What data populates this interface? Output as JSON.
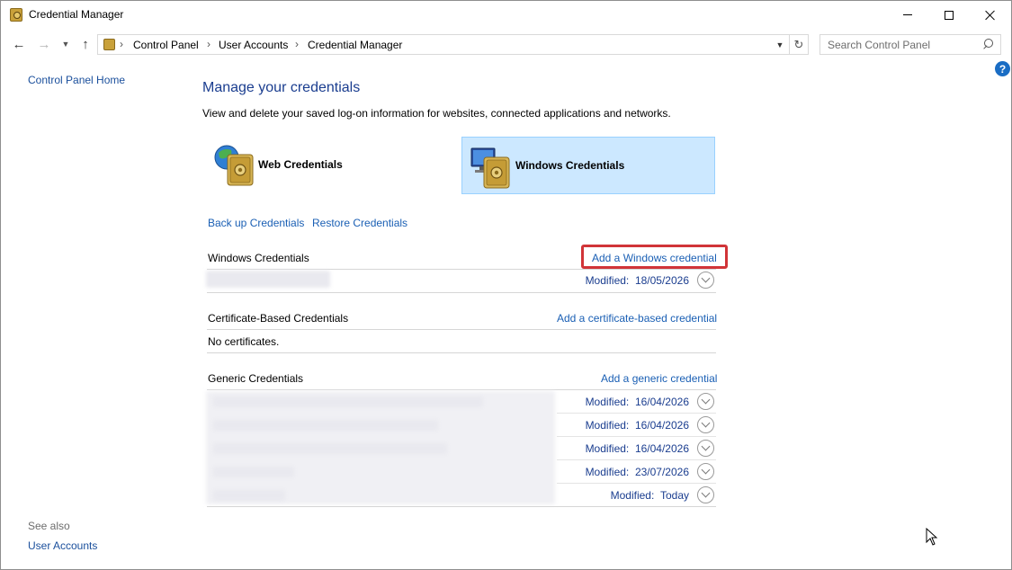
{
  "window": {
    "title": "Credential Manager",
    "buttons": {
      "minimize": "minimize",
      "maximize": "maximize",
      "close": "close"
    }
  },
  "address_bar": {
    "crumbs": [
      "Control Panel",
      "User Accounts",
      "Credential Manager"
    ],
    "search_placeholder": "Search Control Panel"
  },
  "left_nav": {
    "home": "Control Panel Home",
    "see_also": "See also",
    "user_accounts": "User Accounts"
  },
  "main": {
    "title": "Manage your credentials",
    "description": "View and delete your saved log-on information for websites, connected applications and networks.",
    "tiles": {
      "web": "Web Credentials",
      "windows": "Windows Credentials"
    },
    "backup_link": "Back up Credentials",
    "restore_link": "Restore Credentials"
  },
  "sections": {
    "windows": {
      "title": "Windows Credentials",
      "action": "Add a Windows credential",
      "entries": [
        {
          "modified_label": "Modified:",
          "modified_value": "18/05/2026"
        }
      ]
    },
    "certificate": {
      "title": "Certificate-Based Credentials",
      "action": "Add a certificate-based credential",
      "empty": "No certificates."
    },
    "generic": {
      "title": "Generic Credentials",
      "action": "Add a generic credential",
      "entries": [
        {
          "modified_label": "Modified:",
          "modified_value": "16/04/2026"
        },
        {
          "modified_label": "Modified:",
          "modified_value": "16/04/2026"
        },
        {
          "modified_label": "Modified:",
          "modified_value": "16/04/2026"
        },
        {
          "modified_label": "Modified:",
          "modified_value": "23/07/2026"
        },
        {
          "modified_label": "Modified:",
          "modified_value": "Today"
        }
      ]
    }
  },
  "colors": {
    "link": "#1a5fb4",
    "heading": "#1a3d8f",
    "selected_tile": "#cce8ff",
    "highlight_box": "#d13438"
  }
}
